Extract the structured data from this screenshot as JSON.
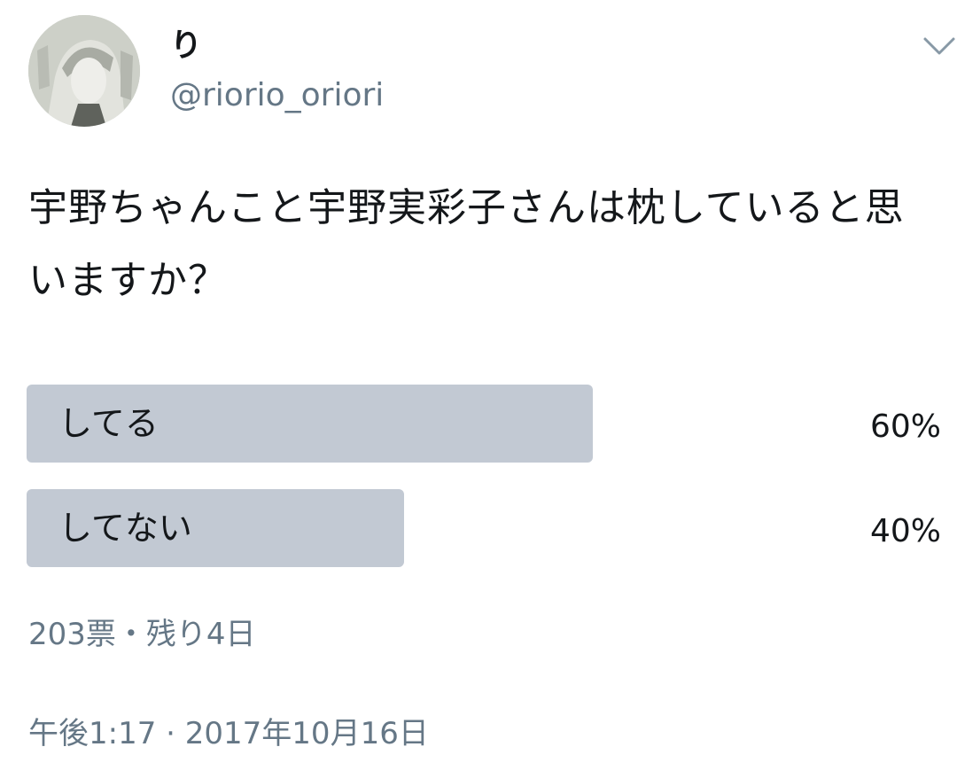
{
  "tweet": {
    "display_name": "り",
    "handle": "@riorio_oriori",
    "text": "宇野ちゃんこと宇野実彩子さんは枕していると思いますか？"
  },
  "poll": {
    "options": [
      {
        "label": "してる",
        "percent_text": "60%",
        "percent": 60
      },
      {
        "label": "してない",
        "percent_text": "40%",
        "percent": 40
      }
    ],
    "meta": "203票・残り4日",
    "bar_color": "#c2c9d3"
  },
  "timestamp": "午後1:17 · 2017年10月16日",
  "icons": {
    "menu": "chevron-down-icon",
    "avatar": "manga-portrait-avatar"
  }
}
